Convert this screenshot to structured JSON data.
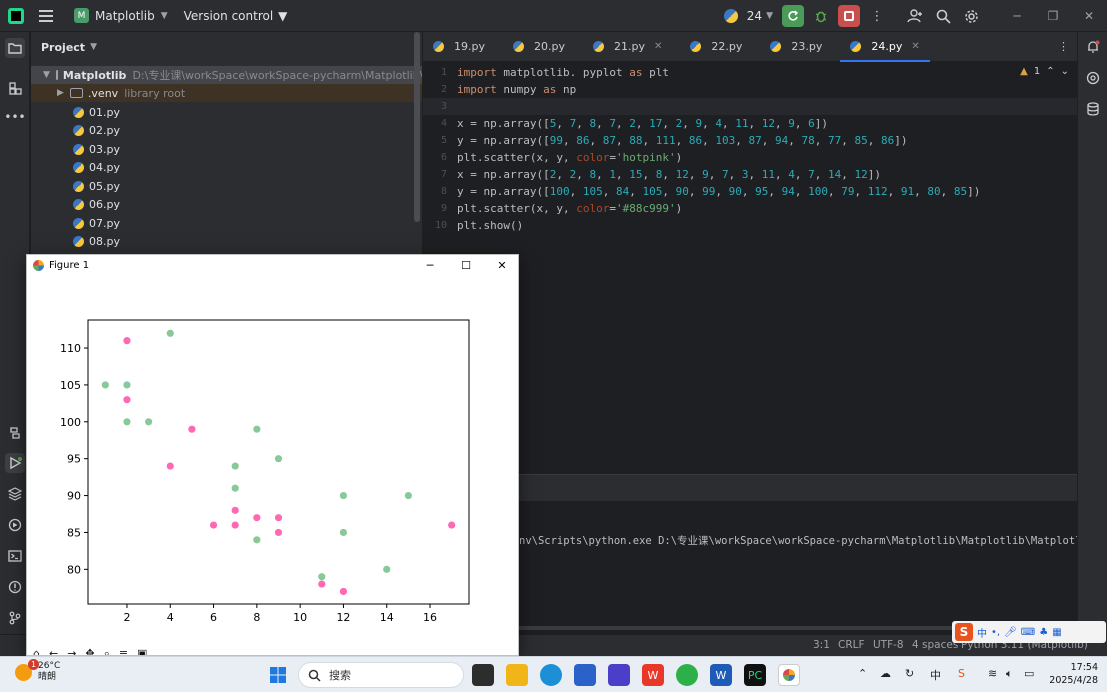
{
  "titlebar": {
    "project_badge": "M",
    "project_name": "Matplotlib",
    "vcs_label": "Version control",
    "python_count": "24"
  },
  "project_panel": {
    "title": "Project",
    "root_name": "Matplotlib",
    "root_path": "D:\\专业课\\workSpace\\workSpace-pycharm\\Matplotlib\\Matplotlib\\",
    "venv_name": ".venv",
    "venv_hint": "library root",
    "files": [
      "01.py",
      "02.py",
      "03.py",
      "04.py",
      "05.py",
      "06.py",
      "07.py",
      "08.py"
    ]
  },
  "tabs": [
    {
      "label": "19.py",
      "active": false,
      "closable": false
    },
    {
      "label": "20.py",
      "active": false,
      "closable": false
    },
    {
      "label": "21.py",
      "active": false,
      "closable": true
    },
    {
      "label": "22.py",
      "active": false,
      "closable": false
    },
    {
      "label": "23.py",
      "active": false,
      "closable": false
    },
    {
      "label": "24.py",
      "active": true,
      "closable": true
    }
  ],
  "editor": {
    "warning_count": "1",
    "line_numbers": [
      "1",
      "2",
      "3",
      "4",
      "5",
      "6",
      "7",
      "8",
      "9",
      "10"
    ],
    "lines": [
      "import matplotlib. pyplot as plt",
      "import numpy as np",
      "",
      "x = np.array([5, 7, 8, 7, 2, 17, 2, 9, 4, 11, 12, 9, 6])",
      "y = np.array([99, 86, 87, 88, 111, 86, 103, 87, 94, 78, 77, 85, 86])",
      "plt.scatter(x, y, color='hotpink')",
      "x = np.array([2, 2, 8, 1, 15, 8, 12, 9, 7, 3, 11, 4, 7, 14, 12])",
      "y = np.array([100, 105, 84, 105, 90, 99, 90, 95, 94, 100, 79, 112, 91, 80, 85])",
      "plt.scatter(x, y, color='#88c999')",
      "plt.show()"
    ]
  },
  "run": {
    "command": "nv\\Scripts\\python.exe D:\\专业课\\workSpace\\workSpace-pycharm\\Matplotlib\\Matplotlib\\Matplotlib"
  },
  "statusbar": {
    "position": "3:1",
    "line_sep": "CRLF",
    "encoding": "UTF-8",
    "indent": "4 spaces",
    "interpreter": "Python 3.11 (Matplotlib)"
  },
  "ime": {
    "lang": "中"
  },
  "figure": {
    "window_title": "Figure 1"
  },
  "chart_data": {
    "type": "scatter",
    "title": "",
    "xlabel": "",
    "ylabel": "",
    "xlim": [
      0.2,
      17.8
    ],
    "ylim": [
      75.3,
      113.8
    ],
    "xticks": [
      "2",
      "4",
      "6",
      "8",
      "10",
      "12",
      "14",
      "16"
    ],
    "yticks": [
      "80",
      "85",
      "90",
      "95",
      "100",
      "105",
      "110"
    ],
    "grid": false,
    "series": [
      {
        "color": "#ff69b4",
        "x": [
          5,
          7,
          8,
          7,
          2,
          17,
          2,
          9,
          4,
          11,
          12,
          9,
          6
        ],
        "y": [
          99,
          86,
          87,
          88,
          111,
          86,
          103,
          87,
          94,
          78,
          77,
          85,
          86
        ]
      },
      {
        "color": "#88c999",
        "x": [
          2,
          2,
          8,
          1,
          15,
          8,
          12,
          9,
          7,
          3,
          11,
          4,
          7,
          14,
          12
        ],
        "y": [
          100,
          105,
          84,
          105,
          90,
          99,
          90,
          95,
          94,
          100,
          79,
          112,
          91,
          80,
          85
        ]
      }
    ]
  },
  "taskbar": {
    "temperature": "26°C",
    "weather": "晴朗",
    "weather_badge": "1",
    "search_placeholder": "搜索",
    "time": "17:54",
    "date": "2025/4/28"
  }
}
